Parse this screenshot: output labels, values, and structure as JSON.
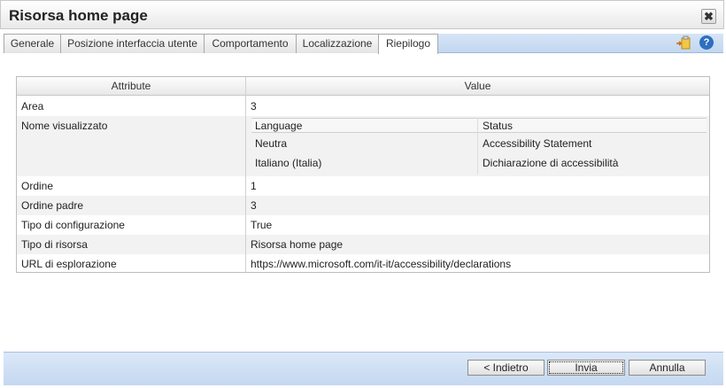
{
  "window": {
    "title": "Risorsa home page",
    "close_glyph": "✖"
  },
  "tabs": [
    {
      "label": "Generale"
    },
    {
      "label": "Posizione interfaccia utente"
    },
    {
      "label": "Comportamento"
    },
    {
      "label": "Localizzazione"
    },
    {
      "label": "Riepilogo",
      "active": true
    }
  ],
  "toolbar": {
    "icons": [
      "export-icon",
      "help-icon"
    ],
    "help_glyph": "?"
  },
  "grid": {
    "columns": {
      "attribute": "Attribute",
      "value": "Value"
    },
    "rows": [
      {
        "attribute": "Area",
        "value": "3"
      },
      {
        "attribute": "Nome visualizzato",
        "value": ""
      },
      {
        "attribute": "Ordine",
        "value": "1"
      },
      {
        "attribute": "Ordine padre",
        "value": "3"
      },
      {
        "attribute": "Tipo di configurazione",
        "value": "True"
      },
      {
        "attribute": "Tipo di risorsa",
        "value": "Risorsa home page"
      },
      {
        "attribute": "URL di esplorazione",
        "value": "https://www.microsoft.com/it-it/accessibility/declarations"
      }
    ],
    "display_name_table": {
      "columns": {
        "language": "Language",
        "status": "Status"
      },
      "rows": [
        {
          "language": "Neutra",
          "status": "Accessibility Statement"
        },
        {
          "language": "Italiano (Italia)",
          "status": "Dichiarazione di accessibilità"
        }
      ]
    }
  },
  "footer": {
    "back": "< Indietro",
    "submit": "Invia",
    "cancel": "Annulla"
  }
}
